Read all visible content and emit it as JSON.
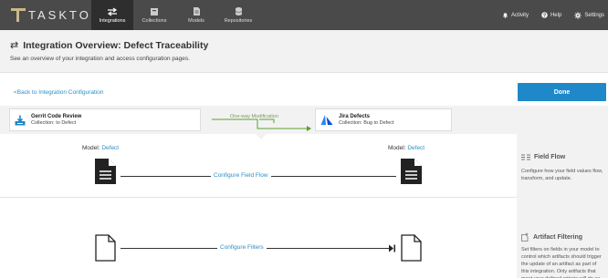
{
  "app": {
    "logo_text": "TASKTOP"
  },
  "nav": {
    "items": [
      {
        "label": "Integrations",
        "icon": "integrations-icon"
      },
      {
        "label": "Collections",
        "icon": "collections-icon"
      },
      {
        "label": "Models",
        "icon": "models-icon"
      },
      {
        "label": "Repositories",
        "icon": "repositories-icon"
      }
    ],
    "active": "Integrations",
    "right": [
      {
        "label": "Activity",
        "icon": "bell-icon"
      },
      {
        "label": "Help",
        "icon": "help-icon"
      },
      {
        "label": "Settings",
        "icon": "gear-icon"
      }
    ]
  },
  "header": {
    "title": "Integration Overview: Defect Traceability",
    "subtitle": "See an overview of your integration and access configuration pages."
  },
  "actions": {
    "back_label": "Back to Integration Configuration",
    "done_label": "Done"
  },
  "connection": {
    "source": {
      "title": "Gerrit Code Review",
      "collection": "Collection: to Defect"
    },
    "flow_label": "One-way Modification",
    "target": {
      "title": "Jira Defects",
      "collection": "Collection: Bug to Defect"
    }
  },
  "mapping": {
    "model_label": "Model:",
    "left_model": "Defect",
    "right_model": "Defect",
    "field_flow_link": "Configure Field Flow",
    "filters_link": "Configure Filters"
  },
  "sidebar": {
    "field_flow": {
      "title": "Field Flow",
      "text": "Configure how your field values flow, transform, and update."
    },
    "artifact_filtering": {
      "title": "Artifact Filtering",
      "text": "Set filters on fields in your model to control which artifacts should trigger the update of an artifact as part of this integration. Only artifacts that meet your defined criteria will do so."
    }
  },
  "colors": {
    "nav_bg": "#4a4a4a",
    "accent": "#1e88c8",
    "link": "#2b8fc4",
    "flow_green": "#5aa02c",
    "panel_bg": "#f2f2f2"
  }
}
